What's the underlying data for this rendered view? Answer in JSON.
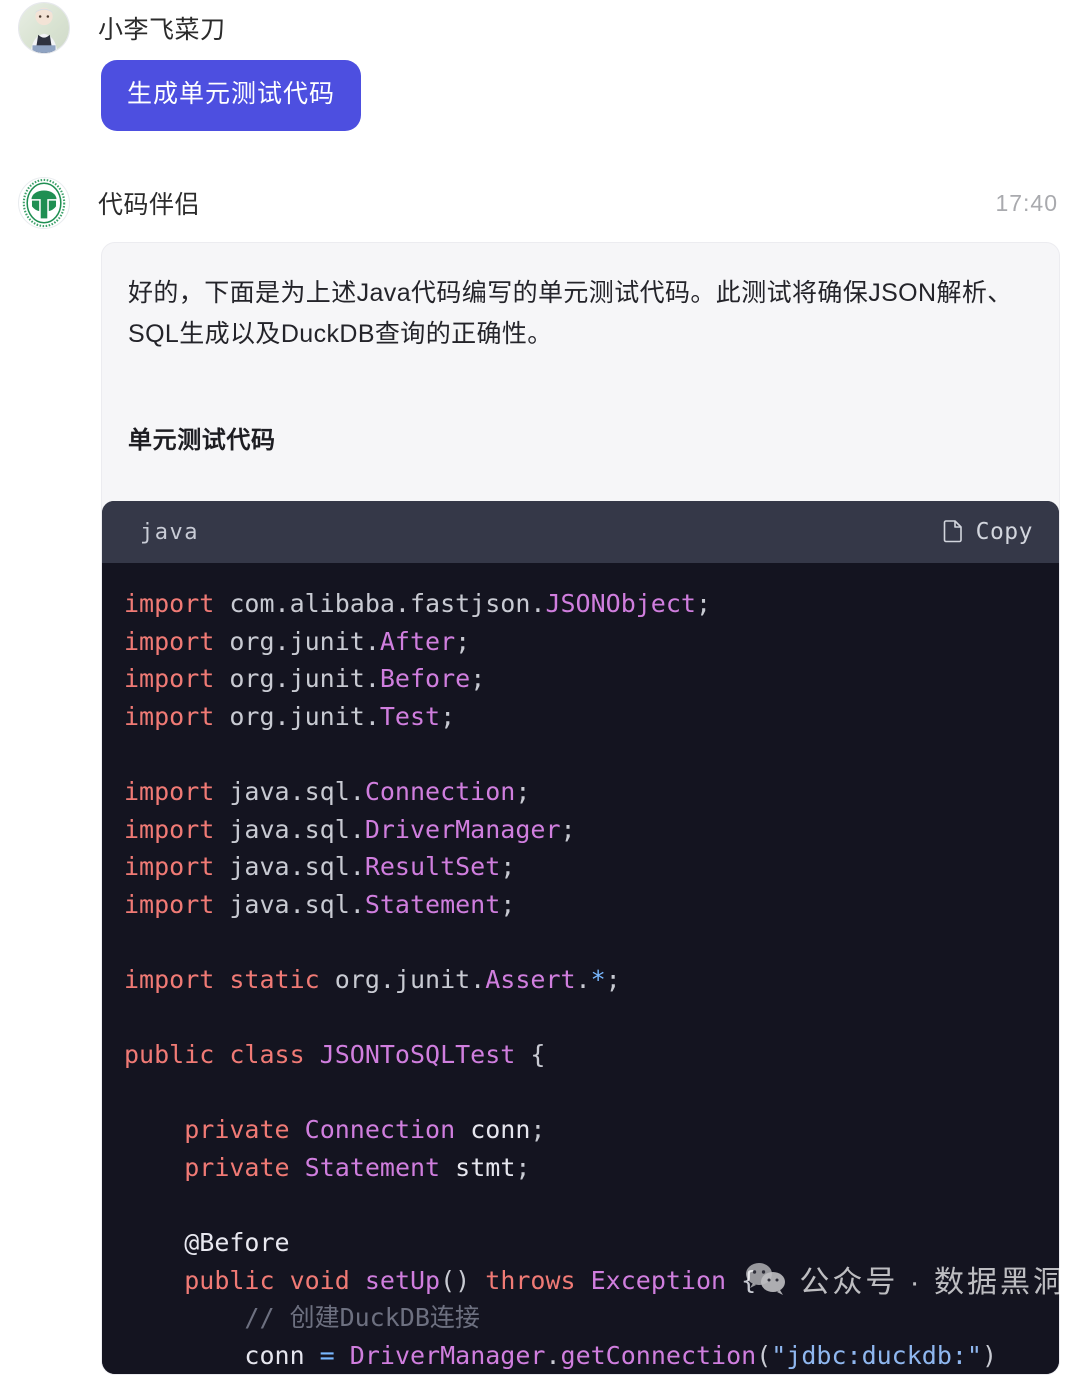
{
  "user": {
    "name": "小李飞菜刀",
    "avatar_icon": "person-photo-avatar",
    "message": "生成单元测试代码"
  },
  "assistant": {
    "name": "代码伴侣",
    "avatar_icon": "green-seal-logo-icon",
    "timestamp": "17:40",
    "paragraph": "好的，下面是为上述Java代码编写的单元测试代码。此测试将确保JSON解析、SQL生成以及DuckDB查询的正确性。",
    "subheading": "单元测试代码",
    "code_block": {
      "language": "java",
      "copy_label": "Copy",
      "copy_icon": "copy-icon",
      "lines": [
        {
          "tokens": [
            {
              "t": "import ",
              "c": "t-kw"
            },
            {
              "t": "com.alibaba.fastjson.",
              "c": "t-pkg"
            },
            {
              "t": "JSONObject",
              "c": "t-type"
            },
            {
              "t": ";",
              "c": "t-punc"
            }
          ]
        },
        {
          "tokens": [
            {
              "t": "import ",
              "c": "t-kw"
            },
            {
              "t": "org.junit.",
              "c": "t-pkg"
            },
            {
              "t": "After",
              "c": "t-type"
            },
            {
              "t": ";",
              "c": "t-punc"
            }
          ]
        },
        {
          "tokens": [
            {
              "t": "import ",
              "c": "t-kw"
            },
            {
              "t": "org.junit.",
              "c": "t-pkg"
            },
            {
              "t": "Before",
              "c": "t-type"
            },
            {
              "t": ";",
              "c": "t-punc"
            }
          ]
        },
        {
          "tokens": [
            {
              "t": "import ",
              "c": "t-kw"
            },
            {
              "t": "org.junit.",
              "c": "t-pkg"
            },
            {
              "t": "Test",
              "c": "t-type"
            },
            {
              "t": ";",
              "c": "t-punc"
            }
          ]
        },
        {
          "tokens": []
        },
        {
          "tokens": [
            {
              "t": "import ",
              "c": "t-kw"
            },
            {
              "t": "java.sql.",
              "c": "t-pkg"
            },
            {
              "t": "Connection",
              "c": "t-type"
            },
            {
              "t": ";",
              "c": "t-punc"
            }
          ]
        },
        {
          "tokens": [
            {
              "t": "import ",
              "c": "t-kw"
            },
            {
              "t": "java.sql.",
              "c": "t-pkg"
            },
            {
              "t": "DriverManager",
              "c": "t-type"
            },
            {
              "t": ";",
              "c": "t-punc"
            }
          ]
        },
        {
          "tokens": [
            {
              "t": "import ",
              "c": "t-kw"
            },
            {
              "t": "java.sql.",
              "c": "t-pkg"
            },
            {
              "t": "ResultSet",
              "c": "t-type"
            },
            {
              "t": ";",
              "c": "t-punc"
            }
          ]
        },
        {
          "tokens": [
            {
              "t": "import ",
              "c": "t-kw"
            },
            {
              "t": "java.sql.",
              "c": "t-pkg"
            },
            {
              "t": "Statement",
              "c": "t-type"
            },
            {
              "t": ";",
              "c": "t-punc"
            }
          ]
        },
        {
          "tokens": []
        },
        {
          "tokens": [
            {
              "t": "import static ",
              "c": "t-kw"
            },
            {
              "t": "org.junit.",
              "c": "t-pkg"
            },
            {
              "t": "Assert",
              "c": "t-type"
            },
            {
              "t": ".",
              "c": "t-punc"
            },
            {
              "t": "*",
              "c": "t-op"
            },
            {
              "t": ";",
              "c": "t-punc"
            }
          ]
        },
        {
          "tokens": []
        },
        {
          "tokens": [
            {
              "t": "public class ",
              "c": "t-kw"
            },
            {
              "t": "JSONToSQLTest",
              "c": "t-type"
            },
            {
              "t": " {",
              "c": "t-punc"
            }
          ]
        },
        {
          "tokens": []
        },
        {
          "tokens": [
            {
              "t": "    ",
              "c": "t-plain"
            },
            {
              "t": "private ",
              "c": "t-kw"
            },
            {
              "t": "Connection",
              "c": "t-type"
            },
            {
              "t": " conn",
              "c": "t-plain"
            },
            {
              "t": ";",
              "c": "t-punc"
            }
          ]
        },
        {
          "tokens": [
            {
              "t": "    ",
              "c": "t-plain"
            },
            {
              "t": "private ",
              "c": "t-kw"
            },
            {
              "t": "Statement",
              "c": "t-type"
            },
            {
              "t": " stmt",
              "c": "t-plain"
            },
            {
              "t": ";",
              "c": "t-punc"
            }
          ]
        },
        {
          "tokens": []
        },
        {
          "tokens": [
            {
              "t": "    ",
              "c": "t-plain"
            },
            {
              "t": "@Before",
              "c": "t-anno"
            }
          ]
        },
        {
          "tokens": [
            {
              "t": "    ",
              "c": "t-plain"
            },
            {
              "t": "public void ",
              "c": "t-kw"
            },
            {
              "t": "setUp",
              "c": "t-fn"
            },
            {
              "t": "() ",
              "c": "t-punc"
            },
            {
              "t": "throws ",
              "c": "t-kw"
            },
            {
              "t": "Exception",
              "c": "t-type"
            },
            {
              "t": " {",
              "c": "t-punc"
            }
          ]
        },
        {
          "tokens": [
            {
              "t": "        // 创建DuckDB连接",
              "c": "t-com"
            }
          ]
        },
        {
          "tokens": [
            {
              "t": "        conn ",
              "c": "t-plain"
            },
            {
              "t": "=",
              "c": "t-op"
            },
            {
              "t": " ",
              "c": "t-plain"
            },
            {
              "t": "DriverManager",
              "c": "t-type"
            },
            {
              "t": ".",
              "c": "t-punc"
            },
            {
              "t": "getConnection",
              "c": "t-fn"
            },
            {
              "t": "(",
              "c": "t-punc"
            },
            {
              "t": "\"jdbc:duckdb:\"",
              "c": "t-str"
            },
            {
              "t": ")",
              "c": "t-punc"
            }
          ]
        }
      ]
    }
  },
  "watermark": {
    "icon": "wechat-icon",
    "text": "公众号 · 数据黑洞"
  }
}
